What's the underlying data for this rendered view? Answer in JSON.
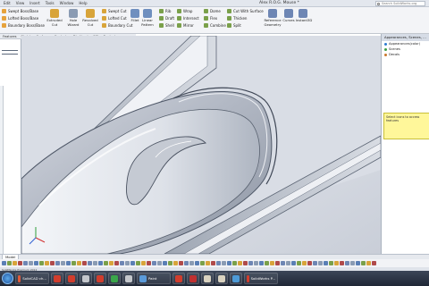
{
  "app": {
    "doc_title": "Alex R.O.G. Mouse *",
    "search_placeholder": "Search SolidWorks.org"
  },
  "menu": [
    "Edit",
    "View",
    "Insert",
    "Tools",
    "Window",
    "Help"
  ],
  "ribbon": {
    "sweep_boss": "Swept Boss/Base",
    "lofted_boss": "Lofted Boss/Base",
    "boundary_boss": "Boundary Boss/Base",
    "extruded_cut": "Extruded\nCut",
    "hole_wizard": "Hole\nWizard",
    "revolved_cut": "Revolved\nCut",
    "swept_cut": "Swept Cut",
    "lofted_cut": "Lofted Cut",
    "boundary_cut": "Boundary Cut",
    "fillet": "Fillet",
    "linear_pattern": "Linear\nPattern",
    "rib": "Rib",
    "wrap": "Wrap",
    "draft": "Draft",
    "intersect": "Intersect",
    "dome": "Dome",
    "shell": "Shell",
    "mirror": "Mirror",
    "flex": "Flex",
    "combine": "Combine",
    "cut_with_surface": "Cut With Surface",
    "thicken": "Thicken",
    "split": "Split",
    "reference_geometry": "Reference\nGeometry",
    "curves": "Curves",
    "instant3d": "Instant3D"
  },
  "command_tabs": [
    "Features",
    "Sketch",
    "Surfaces",
    "Evaluate",
    "DimXpert",
    "Office Products"
  ],
  "task_pane": {
    "header": "Appearances, Scenes, ...",
    "items": [
      {
        "label": "Appearances(color)",
        "color": "#2e7bd0"
      },
      {
        "label": "Scenes",
        "color": "#3b9e44"
      },
      {
        "label": "Decals",
        "color": "#c9772c"
      }
    ],
    "note": "Select icons to access features"
  },
  "model_tab": "Model",
  "status_text": "SolidWorks Premium 2012",
  "taskbar": {
    "items": [
      {
        "label": "SolidCAD ch...",
        "color": "#e05a3a",
        "kind": "wide"
      },
      {
        "label": "",
        "color": "#d13d2d",
        "kind": "small"
      },
      {
        "label": "",
        "color": "#d13d2d",
        "kind": "small"
      },
      {
        "label": "",
        "color": "#c4c7cc",
        "kind": "small"
      },
      {
        "label": "",
        "color": "#d13d2d",
        "kind": "small"
      },
      {
        "label": "",
        "color": "#3aa64a",
        "kind": "small"
      },
      {
        "label": "",
        "color": "#c4c7cc",
        "kind": "small"
      },
      {
        "label": "Paint",
        "color": "#5a9ad9",
        "kind": "wide"
      },
      {
        "label": "",
        "color": "#d13d2d",
        "kind": "small"
      },
      {
        "label": "",
        "color": "#c03030",
        "kind": "small"
      },
      {
        "label": "",
        "color": "#d9d2c0",
        "kind": "small"
      },
      {
        "label": "",
        "color": "#d9d2c0",
        "kind": "small"
      },
      {
        "label": "",
        "color": "#4d9ad6",
        "kind": "small"
      },
      {
        "label": "SolidWorks P...",
        "color": "#d13d2d",
        "kind": "wide"
      }
    ]
  }
}
